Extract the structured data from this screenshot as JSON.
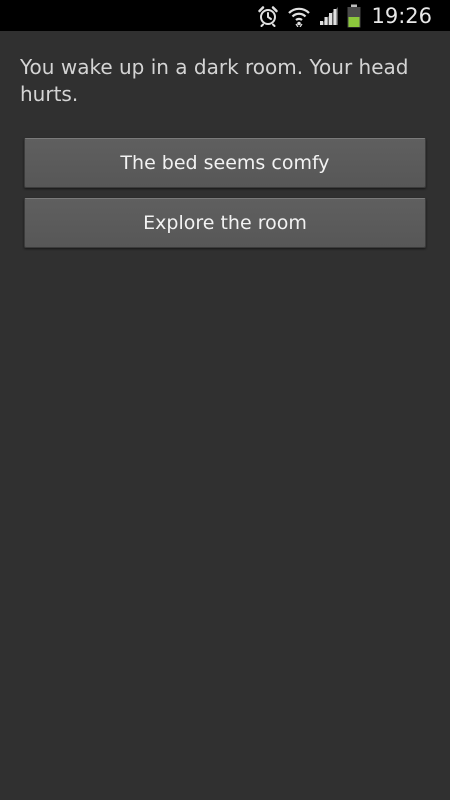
{
  "status_bar": {
    "time": "19:26",
    "icons": [
      "alarm-icon",
      "wifi-icon",
      "signal-icon",
      "battery-icon"
    ],
    "battery_color": "#8cc83c",
    "background": "#000000"
  },
  "story": {
    "text": "You wake up in a dark room. Your head hurts."
  },
  "choices": [
    {
      "label": "The bed seems comfy"
    },
    {
      "label": "Explore the room"
    }
  ],
  "theme": {
    "background": "#303030",
    "button_background": "#5b5b5b",
    "text_color": "#d4d4d4"
  }
}
